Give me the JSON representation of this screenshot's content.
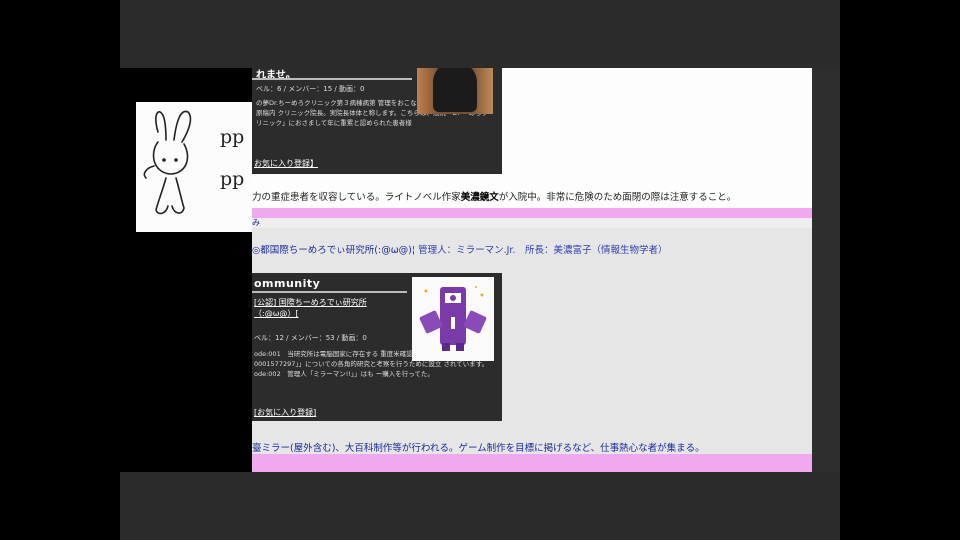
{
  "card1": {
    "title": "れませ。",
    "stats": "ベル：6 / メンバー：15 / 動画：0",
    "desc": "の夢Dr.ちーめろクリニック第３病棟病第 管理をおこなうのでしました。院院長原稿内 クリニック院長。実院長体体と称します。こちらは、法院「Dr ーめろクリニック」におさまして年に重累と認められた患者様",
    "fav": "お気に入り登録】"
  },
  "line1": {
    "pre": "力の重症患者を収容している。ライトノベル作家",
    "bold": "美濃鏡文",
    "post": "が入院中。非常に危険のため面閉の際は注意すること。"
  },
  "pink_label": "み",
  "section2": {
    "title": "◎都国際ちーめろでぃ研究所(:@ω@)¦",
    "manager": "管理人：ミラーマン.Jr.　所長：美濃富子（情報生物学者）"
  },
  "card2": {
    "header": "ommunity",
    "link": "[公認] 国際ちーめろでぃ研究所（:@ω@）[",
    "stats": "ベル：12 / メンバー：53 / 動画：0",
    "desc": "ode:001　当研究所は電脳国家に存在する 重度米確認生物「ちーめろでぃ 0001577297」」についての各角的研究と考察を行うために設立 されています。 ode:002　管理人「ミラーマン!!」」はも ー購入を行ってた。",
    "fav": "[お気に入り登録]"
  },
  "line2": "臺ミラー(屋外含む)、大百科制作等が行われる。ゲーム制作を目標に掲げるなど、仕事熱心な者が集まる。",
  "doodle": {
    "text1": "pp",
    "text2": "pp"
  },
  "colors": {
    "pink": "#f0a8ee",
    "link_blue": "#1a2a9a",
    "card_bg": "#2c2c2c",
    "purple_icon": "#7a3aa8"
  }
}
